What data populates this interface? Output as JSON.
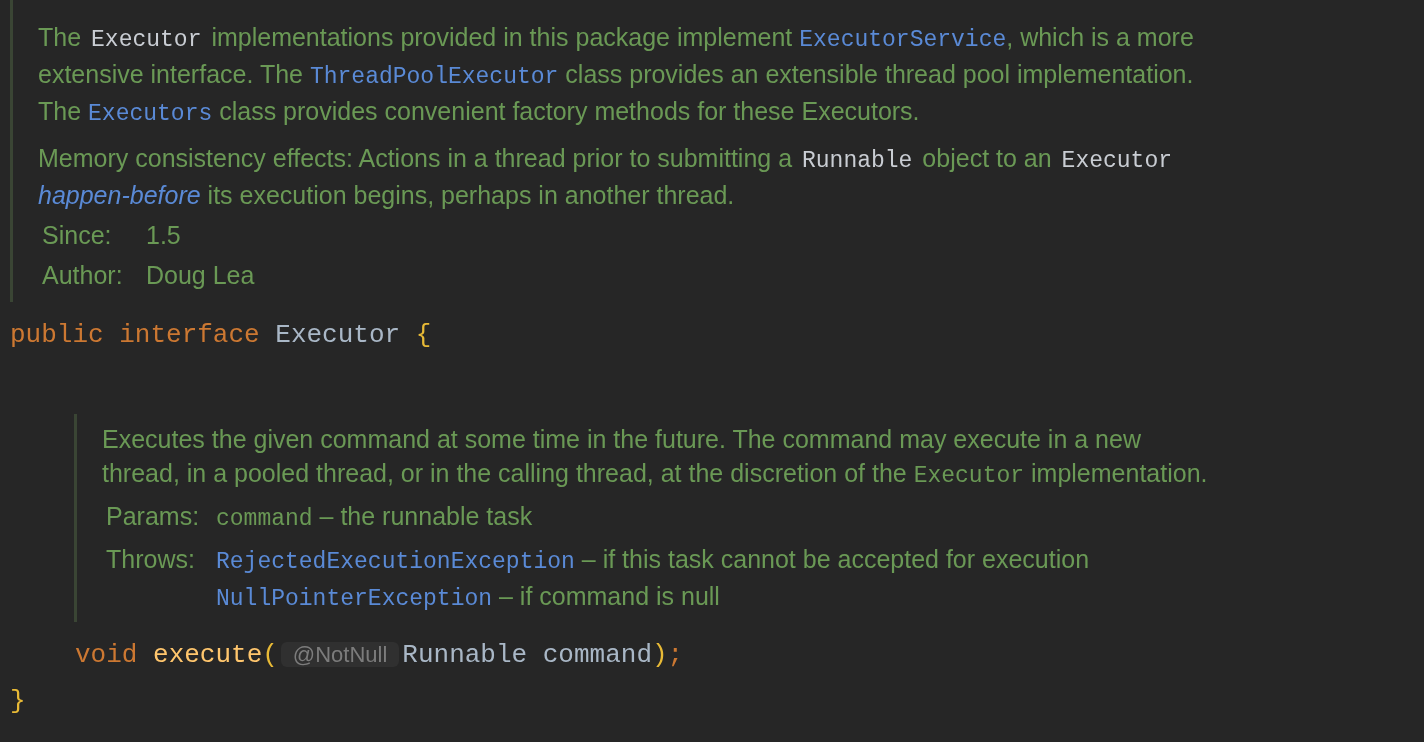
{
  "class_doc": {
    "paragraphs": [
      {
        "lines": [
          [
            {
              "kind": "text",
              "text": "The "
            },
            {
              "kind": "code",
              "text": "Executor"
            },
            {
              "kind": "text",
              "text": " implementations provided in this package implement "
            },
            {
              "kind": "link",
              "text": "ExecutorService"
            },
            {
              "kind": "text",
              "text": ", which is a more"
            }
          ],
          [
            {
              "kind": "text",
              "text": "extensive interface. The "
            },
            {
              "kind": "link",
              "text": "ThreadPoolExecutor"
            },
            {
              "kind": "text",
              "text": " class provides an extensible thread pool implementation."
            }
          ],
          [
            {
              "kind": "text",
              "text": "The "
            },
            {
              "kind": "link",
              "text": "Executors"
            },
            {
              "kind": "text",
              "text": " class provides convenient factory methods for these Executors."
            }
          ]
        ]
      },
      {
        "lines": [
          [
            {
              "kind": "text",
              "text": "Memory consistency effects: Actions in a thread prior to submitting a "
            },
            {
              "kind": "code",
              "text": "Runnable"
            },
            {
              "kind": "text",
              "text": " object to an "
            },
            {
              "kind": "code",
              "text": "Executor"
            }
          ],
          [
            {
              "kind": "italic-link",
              "text": "happen-before"
            },
            {
              "kind": "text",
              "text": " its execution begins, perhaps in another thread."
            }
          ]
        ]
      }
    ],
    "tags": [
      {
        "label": "Since:",
        "entries": [
          [
            {
              "kind": "text",
              "text": "1.5"
            }
          ]
        ]
      },
      {
        "label": "Author:",
        "entries": [
          [
            {
              "kind": "text",
              "text": "Doug Lea"
            }
          ]
        ]
      }
    ]
  },
  "declaration": [
    {
      "kind": "keyword",
      "text": "public"
    },
    {
      "kind": "keyword",
      "text": "interface"
    },
    {
      "kind": "identifier",
      "text": "Executor"
    },
    {
      "kind": "block-brace",
      "text": "{"
    }
  ],
  "method_doc": {
    "paragraphs": [
      {
        "lines": [
          [
            {
              "kind": "text",
              "text": "Executes the given command at some time in the future. The command may execute in a new"
            }
          ],
          [
            {
              "kind": "text",
              "text": "thread, in a pooled thread, or in the calling thread, at the discretion of the "
            },
            {
              "kind": "code-green",
              "text": "Executor"
            },
            {
              "kind": "text",
              "text": " implementation."
            }
          ]
        ]
      }
    ],
    "tags": [
      {
        "label": "Params:",
        "entries": [
          [
            {
              "kind": "code-green",
              "text": "command"
            },
            {
              "kind": "text",
              "text": " – the runnable task"
            }
          ]
        ]
      },
      {
        "label": "Throws:",
        "entries": [
          [
            {
              "kind": "link",
              "text": "RejectedExecutionException"
            },
            {
              "kind": "text",
              "text": " – if this task cannot be accepted for execution"
            }
          ],
          [
            {
              "kind": "link",
              "text": "NullPointerException"
            },
            {
              "kind": "text",
              "text": " – if command is null"
            }
          ]
        ]
      }
    ]
  },
  "method_signature": [
    {
      "kind": "keyword",
      "text": "void"
    },
    {
      "kind": "method",
      "text": "execute"
    },
    {
      "kind": "paren",
      "text": "("
    },
    {
      "kind": "hint",
      "text": "@NotNull"
    },
    {
      "kind": "identifier",
      "text": "Runnable"
    },
    {
      "kind": "identifier",
      "text": "command"
    },
    {
      "kind": "paren",
      "text": ")"
    },
    {
      "kind": "semicolon",
      "text": ";"
    }
  ],
  "closing": [
    {
      "kind": "block-brace",
      "text": "}"
    }
  ]
}
